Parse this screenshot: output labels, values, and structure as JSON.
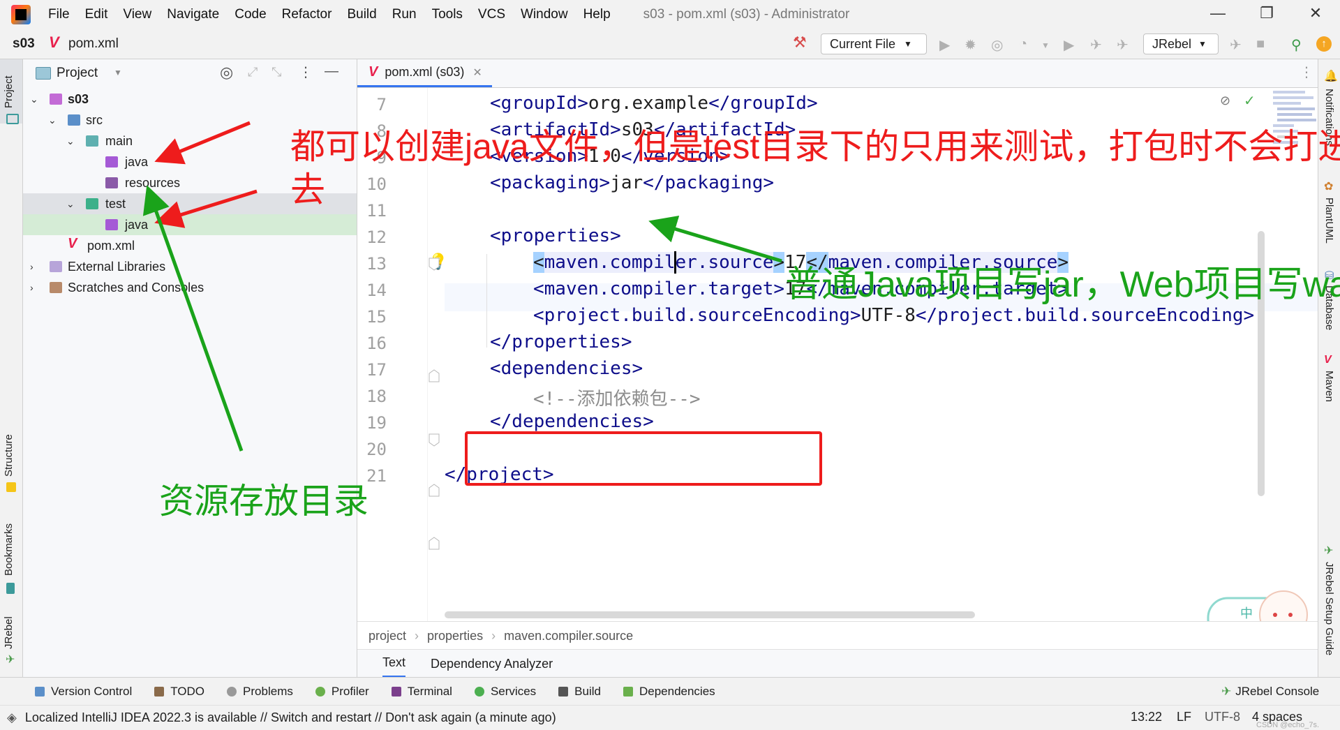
{
  "menubar": {
    "items": [
      "File",
      "Edit",
      "View",
      "Navigate",
      "Code",
      "Refactor",
      "Build",
      "Run",
      "Tools",
      "VCS",
      "Window",
      "Help"
    ],
    "window_title": "s03 - pom.xml (s03) - Administrator"
  },
  "navbar": {
    "project": "s03",
    "file": "pom.xml",
    "run_config": "Current File",
    "jrebel": "JRebel"
  },
  "left_stripe": {
    "project": "Project",
    "structure": "Structure",
    "bookmarks": "Bookmarks",
    "jrebel": "JRebel"
  },
  "right_stripe": {
    "notifications": "Notifications",
    "plantuml": "PlantUML",
    "database": "Database",
    "maven": "Maven",
    "jrebel_guide": "JRebel Setup Guide"
  },
  "project_panel": {
    "title": "Project",
    "tree": [
      "s03",
      "src",
      "main",
      "java",
      "resources",
      "test",
      "java",
      "pom.xml",
      "External Libraries",
      "Scratches and Consoles"
    ]
  },
  "editor": {
    "tab": "pom.xml (s03)",
    "line_numbers": [
      "7",
      "8",
      "9",
      "10",
      "11",
      "12",
      "13",
      "14",
      "15",
      "16",
      "17",
      "18",
      "19",
      "20",
      "21"
    ],
    "lines": {
      "l7": {
        "open": "<groupId>",
        "val": "org.example",
        "close": "</groupId>"
      },
      "l8": {
        "open": "<artifactId>",
        "val": "s03",
        "close": "</artifactId>"
      },
      "l9": {
        "open": "<version>",
        "val": "1.0",
        "close": "</version>"
      },
      "l10": {
        "open": "<packaging>",
        "val": "jar",
        "close": "</packaging>"
      },
      "l12": {
        "open": "<properties>"
      },
      "l13": {
        "lt": "<",
        "name": "maven.compiler.source",
        "gt": ">",
        "val": "17",
        "lt2": "</",
        "name2": "maven.compiler.source",
        "gt2": ">"
      },
      "l14": {
        "lt": "<",
        "name": "maven.compiler.target",
        "gt": ">",
        "val": "17",
        "lt2": "</",
        "name2": "maven.compiler.target",
        "gt2": ">"
      },
      "l15": {
        "lt": "<",
        "name": "project.build.sourceEncoding",
        "gt": ">",
        "val": "UTF-8",
        "lt2": "</",
        "name2": "project.build.sourceEncoding",
        "gt2": ">"
      },
      "l16": {
        "close": "</properties>"
      },
      "l17": {
        "open": "<dependencies>"
      },
      "l18": {
        "comment": "<!--添加依赖包-->"
      },
      "l19": {
        "close": "</dependencies>"
      },
      "l21": {
        "close": "</project>"
      }
    },
    "breadcrumb": [
      "project",
      "properties",
      "maven.compiler.source"
    ],
    "bottom_tabs": [
      "Text",
      "Dependency Analyzer"
    ]
  },
  "tool_windows": [
    "Version Control",
    "TODO",
    "Problems",
    "Profiler",
    "Terminal",
    "Services",
    "Build",
    "Dependencies",
    "JRebel Console"
  ],
  "status": {
    "message": "Localized IntelliJ IDEA 2022.3 is available // Switch and restart // Don't ask again (a minute ago)",
    "position": "13:22",
    "line_sep": "LF",
    "encoding": "UTF-8",
    "indent": "4 spaces",
    "watermark": "CSDN @echo_7s."
  },
  "annotations": {
    "red": "都可以创建java文件，但是test目录下的只用来测试，打包时不会打进去",
    "red_line1": "都可以创建java文件，但是test目录下的只用来测试，打包时不会打进",
    "red_line2": "去",
    "green_packaging": "普通Java项目写jar，Web项目写war",
    "green_resources": "资源存放目录"
  },
  "colors": {
    "red_annotation": "#ee1c1c",
    "green_annotation": "#1aa31a",
    "tag": "#0e0e8a",
    "accent": "#3574f0"
  }
}
